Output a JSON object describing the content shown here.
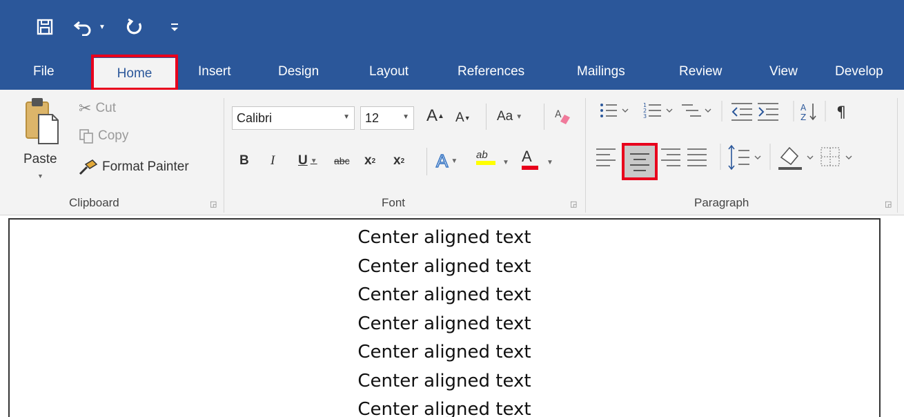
{
  "quick_access": {
    "save_icon": "save-icon",
    "undo_icon": "undo-icon",
    "undo_dropdown_icon": "chevron-down-icon",
    "redo_icon": "redo-icon",
    "customize_icon": "customize-qat-icon"
  },
  "tabs": [
    "File",
    "Home",
    "Insert",
    "Design",
    "Layout",
    "References",
    "Mailings",
    "Review",
    "View",
    "Develop"
  ],
  "active_tab": "Home",
  "clipboard": {
    "paste_label": "Paste",
    "cut_label": "Cut",
    "copy_label": "Copy",
    "format_painter_label": "Format Painter",
    "group_label": "Clipboard"
  },
  "font": {
    "font_name": "Calibri",
    "font_size": "12",
    "grow_label": "A",
    "shrink_label": "A",
    "change_case_label": "Aa",
    "bold_label": "B",
    "italic_label": "I",
    "underline_label": "U",
    "strikethrough_label": "abc",
    "subscript_label": "x",
    "superscript_label": "x",
    "text_effects_label": "A",
    "highlight_label": "ab",
    "font_color_label": "A",
    "group_label": "Font",
    "highlight_color": "#ffff00",
    "font_color": "#e8001c"
  },
  "paragraph": {
    "group_label": "Paragraph",
    "selected_alignment": "center"
  },
  "colors": {
    "title_bar": "#2b579a",
    "ribbon": "#f3f3f3",
    "highlight_box": "#e8001c"
  },
  "document": {
    "lines": [
      "Center aligned text",
      "Center aligned text",
      "Center aligned text",
      "Center aligned text",
      "Center aligned text",
      "Center aligned text",
      "Center aligned text"
    ]
  }
}
